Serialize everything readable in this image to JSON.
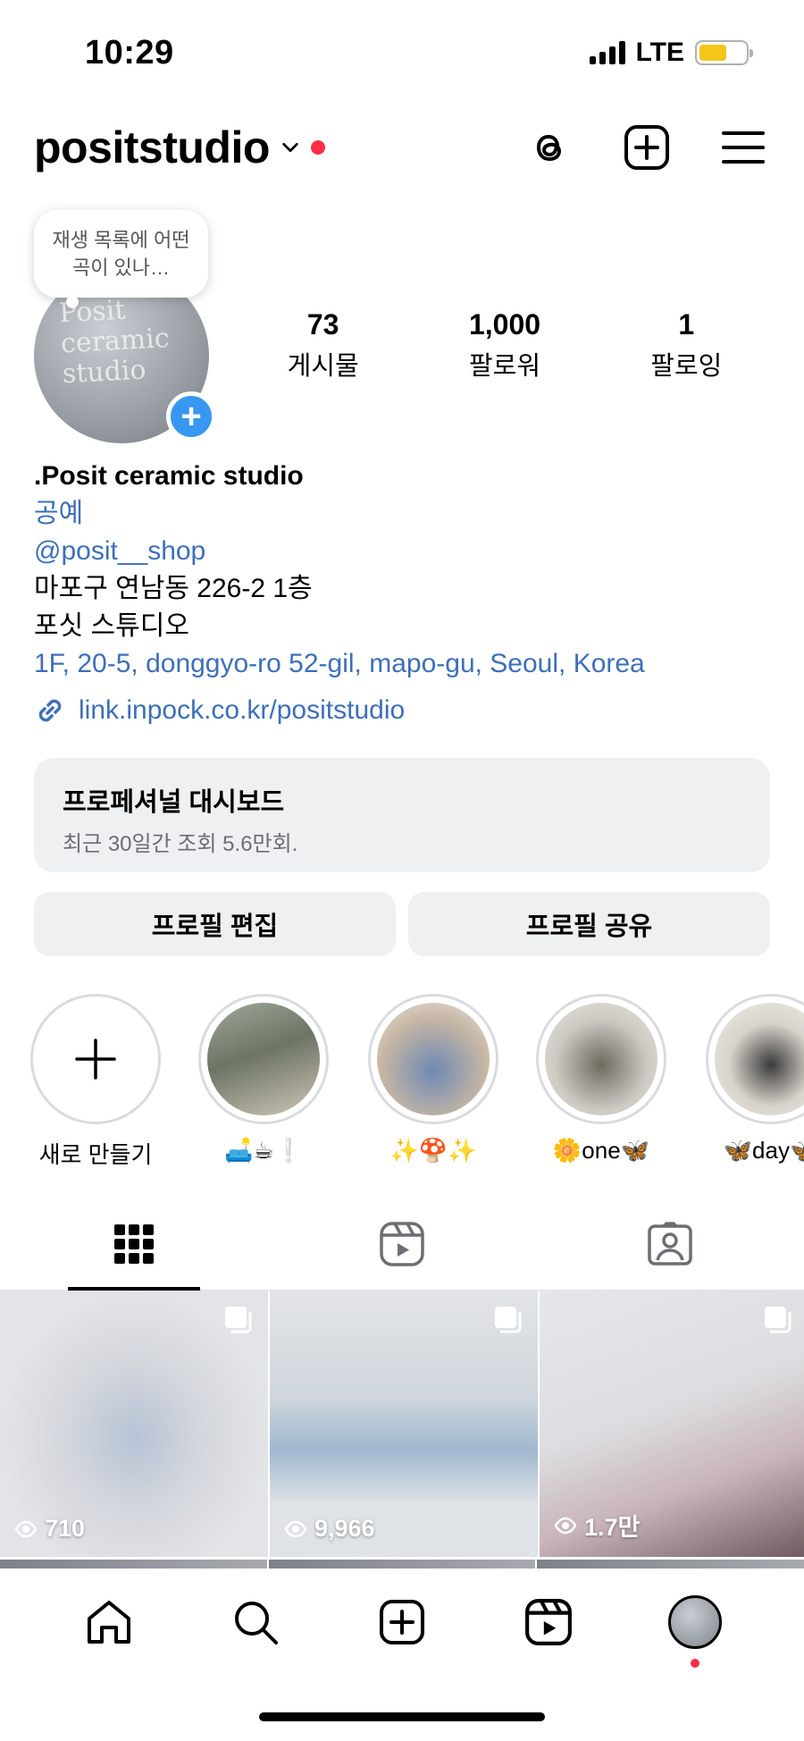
{
  "status_bar": {
    "time": "10:29",
    "network": "LTE",
    "battery_color": "#f5c518"
  },
  "header": {
    "username": "positstudio",
    "notification_dot_color": "#ff2d46"
  },
  "note": {
    "text": "재생 목록에 어떤 곡이 있나…"
  },
  "profile": {
    "avatar_text": "Posit ceramic studio",
    "stats": [
      {
        "value": "73",
        "label": "게시물"
      },
      {
        "value": "1,000",
        "label": "팔로워"
      },
      {
        "value": "1",
        "label": "팔로잉"
      }
    ]
  },
  "bio": {
    "name": ".Posit ceramic studio",
    "category": "공예",
    "mention": "@posit__shop",
    "line1": "마포구 연남동 226-2 1층",
    "line2": "포싯 스튜디오",
    "address": "1F, 20-5, donggyo-ro 52-gil, mapo-gu, Seoul, Korea",
    "url": "link.inpock.co.kr/positstudio",
    "link_color": "#3d6fb9"
  },
  "dashboard": {
    "title": "프로페셔널 대시보드",
    "subtitle": "최근 30일간 조회 5.6만회."
  },
  "buttons": {
    "edit": "프로필 편집",
    "share": "프로필 공유"
  },
  "highlights": [
    {
      "label": "새로 만들기"
    },
    {
      "label": "🛋️☕❕"
    },
    {
      "label": "✨🍄✨"
    },
    {
      "label": "🌼one🦋"
    },
    {
      "label": "🦋day🦋"
    }
  ],
  "posts": [
    {
      "views": "710"
    },
    {
      "views": "9,966"
    },
    {
      "views": "1.7만"
    }
  ],
  "accent_color": "#3897f0"
}
